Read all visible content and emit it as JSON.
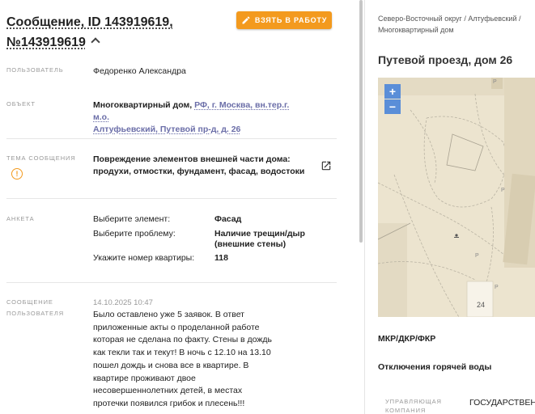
{
  "header": {
    "title_line1": "Сообщение, ID 143919619,",
    "title_line2": "№143919619",
    "take_button": "ВЗЯТЬ В РАБОТУ"
  },
  "details": {
    "user_label": "ПОЛЬЗОВАТЕЛЬ",
    "user_value": "Федоренко Александра",
    "object_label": "ОБЪЕКТ",
    "object_type": "Многоквартирный дом,",
    "object_address_1": "РФ, г. Москва, вн.тер.г. м.о.",
    "object_address_2": "Алтуфьевский, Путевой пр-д, д. 26",
    "topic_label": "ТЕМА СООБЩЕНИЯ",
    "topic_line1": "Повреждение элементов внешней части дома:",
    "topic_line2": "продухи, отмостки, фундамент, фасад, водостоки",
    "survey_label": "АНКЕТА",
    "survey": [
      {
        "q": "Выберите элемент:",
        "a": "Фасад"
      },
      {
        "q": "Выберите проблему:",
        "a": "Наличие трещин/дыр (внешние стены)"
      },
      {
        "q": "Укажите номер квартиры:",
        "a": "118"
      }
    ],
    "message_label_1": "СООБЩЕНИЕ",
    "message_label_2": "ПОЛЬЗОВАТЕЛЯ",
    "message_time": "14.10.2025 10:47",
    "message_text": "Было оставлено уже 5 заявок. В ответ приложенные акты о проделанной работе которая не сделана по факту. Стены в дождь как текли так и текут! В ночь с 12.10 на 13.10 пошел дождь и снова все в квартире. В квартире проживают двое несовершеннолетних детей, в местах протечки появился грибок и плесень!!!"
  },
  "sidebar": {
    "breadcrumb_1": "Северо-Восточный округ / Алтуфьевский /",
    "breadcrumb_2": "Многоквартирный дом",
    "address": "Путевой проезд, дом 26",
    "map": {
      "zoom_in": "+",
      "zoom_out": "−",
      "building_number": "24",
      "parking_mark_1": "P",
      "parking_mark_2": "P",
      "parking_mark_3": "P",
      "parking_mark_4": "P"
    },
    "row1": "МКР/ДКР/ФКР",
    "row2": "Отключения горячей воды",
    "mgmt_label_1": "УПРАВЛЯЮЩАЯ",
    "mgmt_label_2": "КОМПАНИЯ",
    "mgmt_value": "ГОСУДАРСТВЕННОЕ"
  },
  "colors": {
    "accent": "#f39a1e",
    "link": "#6b6ea8",
    "zoom": "#5a8ed8",
    "map_bg": "#ece4cf"
  }
}
